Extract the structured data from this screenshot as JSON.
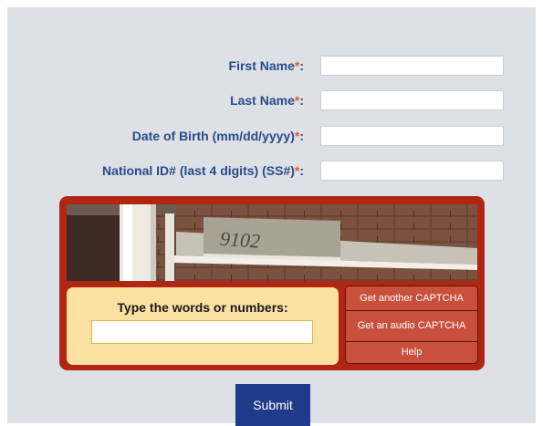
{
  "form": {
    "fields": [
      {
        "label": "First Name",
        "required_mark": "*",
        "colon": ":",
        "value": ""
      },
      {
        "label": "Last Name",
        "required_mark": "*",
        "colon": ":",
        "value": ""
      },
      {
        "label": "Date of Birth (mm/dd/yyyy)",
        "required_mark": "*",
        "colon": ":",
        "value": ""
      },
      {
        "label": "National ID# (last 4 digits) (SS#)",
        "required_mark": "*",
        "colon": ":",
        "value": ""
      }
    ],
    "submit_label": "Submit"
  },
  "captcha": {
    "image_text": "9102",
    "prompt": "Type the words or numbers:",
    "response_value": "",
    "buttons": {
      "get_another": "Get another CAPTCHA",
      "audio": "Get an audio CAPTCHA",
      "help": "Help"
    }
  },
  "colors": {
    "background": "#dde1e5",
    "label": "#2b4a8c",
    "required": "#e35a2a",
    "captcha_frame": "#b22512",
    "captcha_button": "#c9503c",
    "prompt_box": "#fbe1a1",
    "submit": "#1f3b8a"
  }
}
